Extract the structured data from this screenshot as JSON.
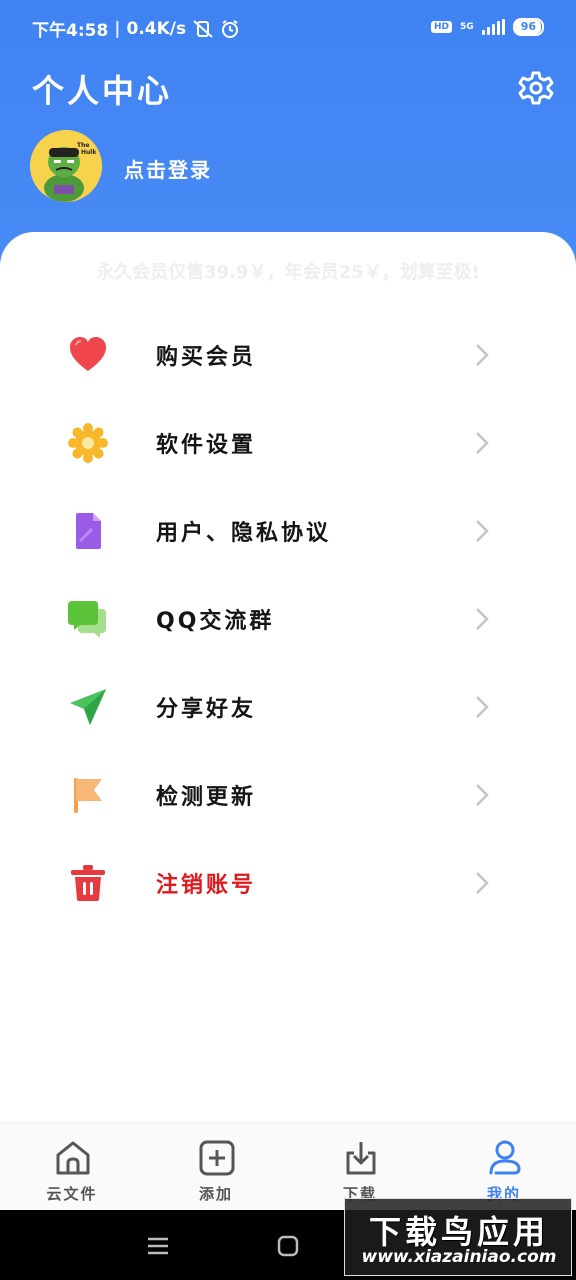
{
  "status_bar": {
    "time": "下午4:58",
    "net_speed": "0.4K/s",
    "network": "5G",
    "hd": "HD",
    "battery": "96",
    "battery_level": 0.96
  },
  "header": {
    "title": "个人中心",
    "settings_icon": "gear-icon",
    "login_text": "点击登录",
    "avatar_text": "The Hulk"
  },
  "promo": {
    "text": "永久会员仅售39.9￥，年会员25￥，划算至极!"
  },
  "menu": {
    "items": [
      {
        "label": "购买会员",
        "icon": "heart-icon",
        "color": "#f0474c"
      },
      {
        "label": "软件设置",
        "icon": "gear-icon",
        "color": "#f7b92b"
      },
      {
        "label": "用户、隐私协议",
        "icon": "document-icon",
        "color": "#9a5ce6"
      },
      {
        "label": "QQ交流群",
        "icon": "chat-icon",
        "color": "#5cc43a"
      },
      {
        "label": "分享好友",
        "icon": "send-icon",
        "color": "#4ac35c"
      },
      {
        "label": "检测更新",
        "icon": "flag-icon",
        "color": "#f6a14a"
      },
      {
        "label": "注销账号",
        "icon": "trash-icon",
        "color": "#e53a3f",
        "danger": true
      }
    ]
  },
  "bottom_nav": {
    "tabs": [
      {
        "label": "云文件",
        "icon": "home-icon"
      },
      {
        "label": "添加",
        "icon": "add-icon"
      },
      {
        "label": "下载",
        "icon": "download-icon"
      },
      {
        "label": "我的",
        "icon": "user-icon",
        "active": true
      }
    ]
  },
  "watermark": {
    "brand": "下载鸟应用",
    "url": "www.xiazainiao.com"
  },
  "colors": {
    "brand_blue": "#3f82f2",
    "danger_red": "#e0191e"
  }
}
